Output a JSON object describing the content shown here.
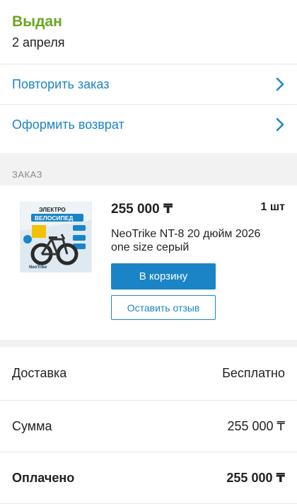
{
  "status": {
    "title": "Выдан",
    "date": "2 апреля"
  },
  "actions": [
    {
      "label": "Повторить заказ"
    },
    {
      "label": "Оформить возврат"
    }
  ],
  "section": {
    "title": "ЗАКАЗ"
  },
  "item": {
    "price": "255 000 ₸",
    "quantity": "1 шт",
    "name_line1": "NeoTrike NT-8 20 дюйм 2026",
    "name_line2": "one size серый",
    "image_text": {
      "line1": "ЭЛЕКТРО",
      "line2": "ВЕЛОСИПЕД",
      "brand": "NeoTrike"
    },
    "cart_button": "В корзину",
    "review_button": "Оставить отзыв"
  },
  "summary": {
    "delivery_label": "Доставка",
    "delivery_value": "Бесплатно",
    "sum_label": "Сумма",
    "sum_value": "255 000 ₸",
    "paid_label": "Оплачено",
    "paid_value": "255 000 ₸"
  },
  "colors": {
    "status_green": "#6aa51f",
    "accent_blue": "#1a84c7",
    "band_gray": "#f2f2f2"
  }
}
